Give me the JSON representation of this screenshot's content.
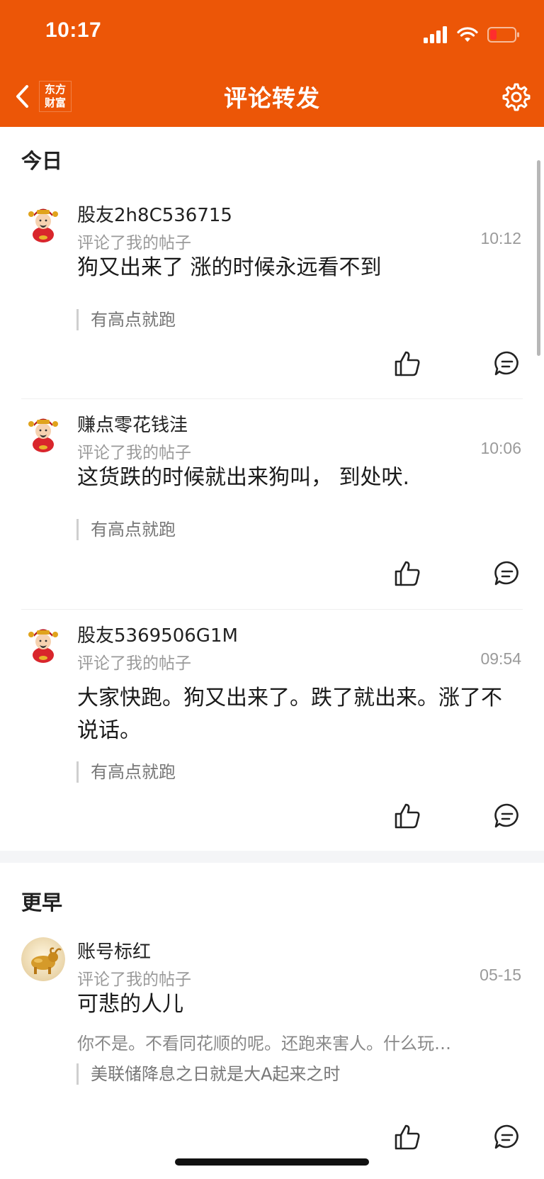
{
  "status_bar": {
    "time": "10:17"
  },
  "nav": {
    "title": "评论转发",
    "brand_line1": "东方",
    "brand_line2": "财富"
  },
  "sections": [
    {
      "title": "今日"
    },
    {
      "title": "更早"
    }
  ],
  "items": [
    {
      "username": "股友2h8C536715",
      "action": "评论了我的帖子",
      "time": "10:12",
      "comment": "狗又出来了 涨的时候永远看不到",
      "quote": "有高点就跑"
    },
    {
      "username": "赚点零花钱洼",
      "action": "评论了我的帖子",
      "time": "10:06",
      "comment": "这货跌的时候就出来狗叫，  到处吠.",
      "quote": "有高点就跑"
    },
    {
      "username": "股友5369506G1M",
      "action": "评论了我的帖子",
      "time": "09:54",
      "comment": "大家快跑。狗又出来了。跌了就出来。涨了不说话。",
      "quote": "有高点就跑"
    },
    {
      "username": "账号标红",
      "action": "评论了我的帖子",
      "time": "05-15",
      "comment": "可悲的人儿",
      "original_post": "你不是。不看同花顺的呢。还跑来害人。什么玩…",
      "quote": "美联储降息之日就是大A起来之时"
    }
  ],
  "colors": {
    "brand": "#ec5607",
    "secondary_text": "#9a9a9a"
  },
  "icons": [
    "back-chevron-icon",
    "gear-icon",
    "thumbs-up-icon",
    "comment-bubble-icon",
    "signal-icon",
    "wifi-icon",
    "battery-icon"
  ]
}
